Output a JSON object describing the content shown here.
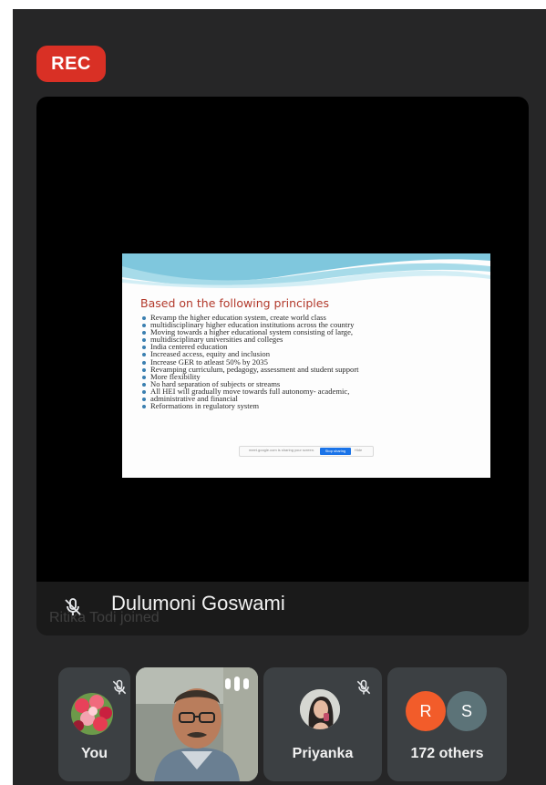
{
  "recording": {
    "label": "REC",
    "color": "#d93025"
  },
  "presenter": {
    "name": "Dulumoni Goswami",
    "mic": "mic-off-icon"
  },
  "toast": {
    "text": "Ritika Todi joined"
  },
  "slide": {
    "title": "Based on the following principles",
    "bullets": [
      "Revamp the higher education system, create world class",
      "multidisciplinary higher education institutions across the country",
      "Moving towards a higher educational system consisting of large,",
      "multidisciplinary universities and colleges",
      "India centered education",
      "Increased access, equity and inclusion",
      "Increase GER to atleast 50% by 2035",
      "Revamping curriculum, pedagogy, assessment  and student support",
      "More flexibility",
      "No hard separation of subjects or streams",
      "All HEI will gradually move towards full autonomy- academic,",
      "administrative and financial",
      "Reformations in regulatory system"
    ],
    "share_bar": {
      "text": "meet.google.com is sharing your screen.",
      "stop_label": "Stop sharing",
      "hide_label": "Hide"
    }
  },
  "participants": {
    "you": {
      "label": "You",
      "mic": "mic-off-icon"
    },
    "video": {
      "indicator": "speaking-icon"
    },
    "priyanka": {
      "label": "Priyanka",
      "mic": "mic-off-icon"
    },
    "others": {
      "label": "172 others",
      "avatar_r": "R",
      "avatar_s": "S",
      "color_r": "#f25c2a",
      "color_s": "#5c7378"
    }
  }
}
